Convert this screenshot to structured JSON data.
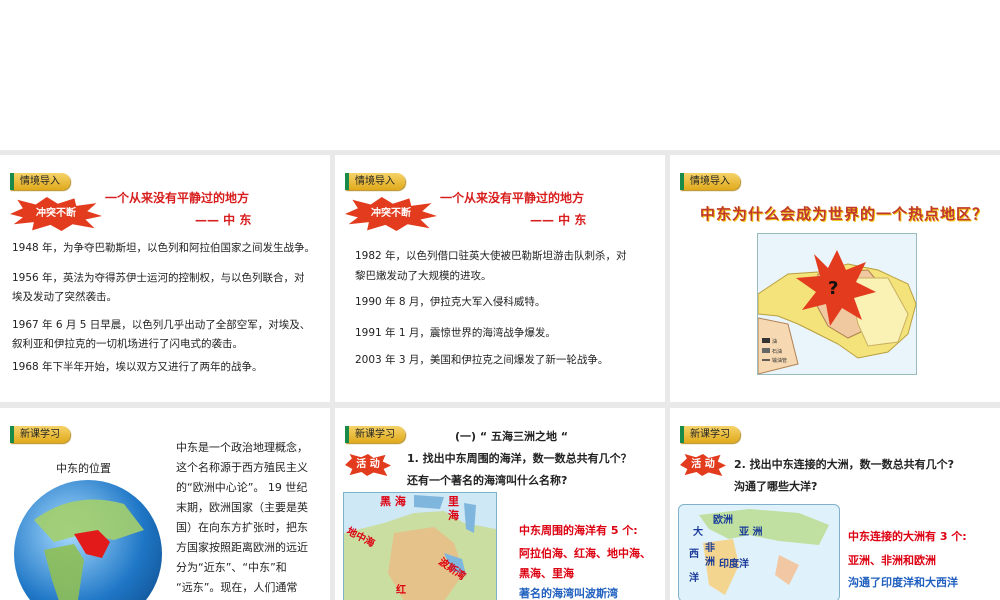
{
  "slides": [
    {
      "tag": "情境导入",
      "burst": "冲突不断",
      "title": "一个从来没有平静过的地方",
      "subtitle": "—— 中  东",
      "paragraphs": [
        "1948 年，为争夺巴勒斯坦，以色列和阿拉伯国家之间发生战争。",
        "1956 年，英法为夺得苏伊士运河的控制权，与以色列联合，对",
        "埃及发动了突然袭击。",
        "1967 年 6 月 5 日早晨，以色列几乎出动了全部空军，对埃及、",
        "叙利亚和伊拉克的一切机场进行了闪电式的袭击。",
        "1968 年下半年开始，埃以双方又进行了两年的战争。"
      ]
    },
    {
      "tag": "情境导入",
      "burst": "冲突不断",
      "title": "一个从来没有平静过的地方",
      "subtitle": "—— 中  东",
      "paragraphs": [
        "1982 年，以色列借口驻英大使被巴勒斯坦游击队刺杀，对",
        "黎巴嫩发动了大规模的进攻。",
        "1990 年 8 月，伊拉克大军入侵科威特。",
        "1991 年 1 月，震惊世界的海湾战争爆发。",
        "2003 年 3 月，美国和伊拉克之间爆发了新一轮战争。"
      ]
    },
    {
      "tag": "情境导入",
      "question": "中东为什么会成为世界的一个热点地区？",
      "mark": "?",
      "legend": [
        "油",
        "石油",
        "输油管"
      ]
    },
    {
      "tag": "新课学习",
      "caption": "中东的位置",
      "text_lines": [
        "中东是一个政治地理概念，",
        "这个名称源于西方殖民主义",
        "的“欧洲中心论”。 19 世纪",
        "末期，欧洲国家（主要是英",
        "国）在向东方扩张时，把东",
        "方国家按照距离欧洲的远近",
        "分为“近东”、“中东”和",
        "“远东”。现在，人们通常"
      ]
    },
    {
      "tag": "新课学习",
      "heading": "(一)  “ 五海三洲之地 “",
      "activity": "活 动",
      "q1": "1. 找出中东周围的海洋，数一数总共有几个？",
      "q2": "还有一个著名的海湾叫什么名称?",
      "map_labels": [
        "黑 海",
        "里",
        "海",
        "地中海",
        "波斯湾",
        "红"
      ],
      "answer_title": "中东周围的海洋有 5 个:",
      "answer_lines": [
        "阿拉伯海、红海、地中海、",
        "黑海、里海",
        "著名的海湾叫波斯湾"
      ]
    },
    {
      "tag": "新课学习",
      "activity": "活 动",
      "q1": "2. 找出中东连接的大洲，数一数总共有几个?",
      "q2": "沟通了哪些大洋?",
      "map_labels": [
        "欧洲",
        "亚 洲",
        "大",
        "非",
        "洲",
        "西",
        "洋",
        "印度洋"
      ],
      "answer_title": "中东连接的大洲有 3 个:",
      "answer_line1": "亚洲、非洲和欧洲",
      "answer_line2": "沟通了印度洋和大西洋"
    }
  ]
}
